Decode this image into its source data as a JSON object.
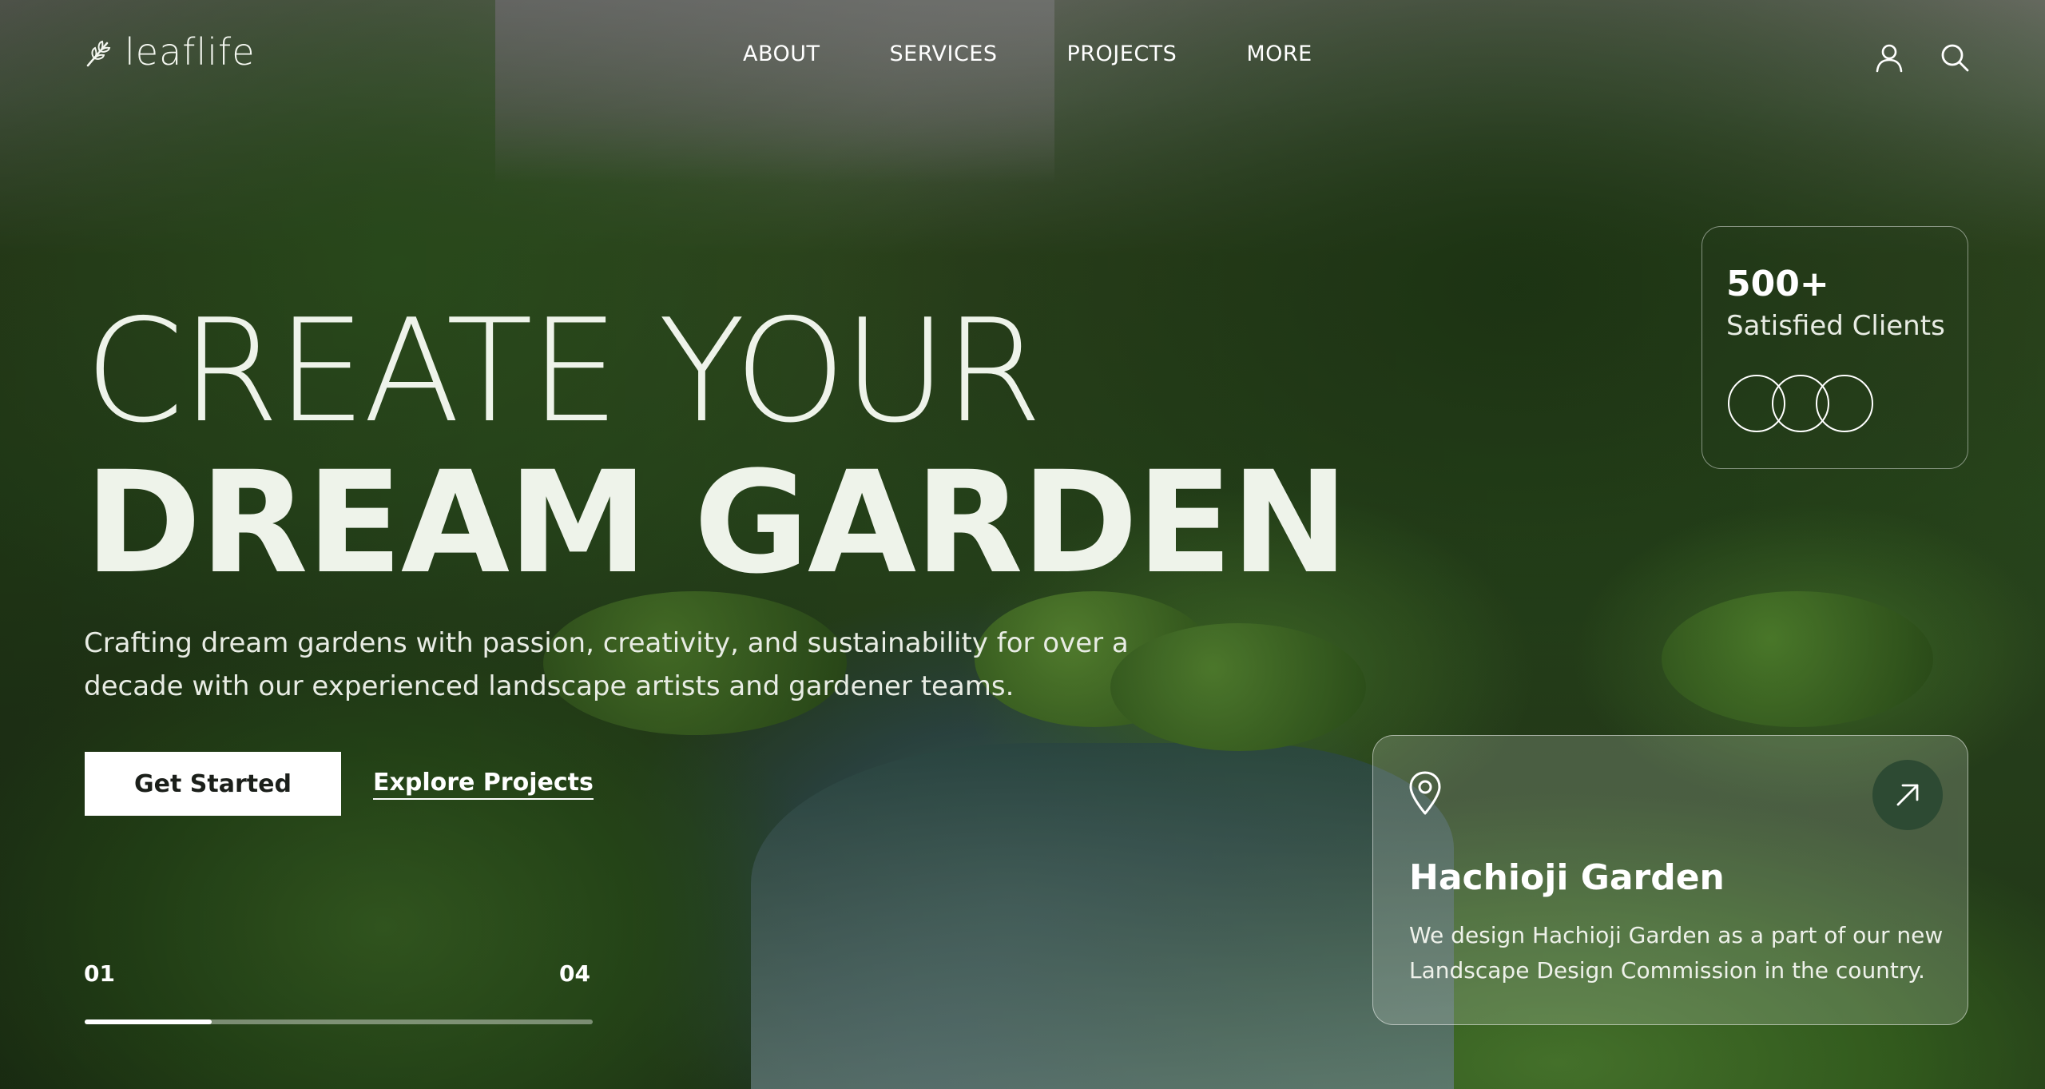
{
  "brand": {
    "name": "leaflife",
    "accent": "#2d4a33",
    "text_color": "#f4f7f0"
  },
  "nav": {
    "items": [
      {
        "label": "ABOUT"
      },
      {
        "label": "SERVICES"
      },
      {
        "label": "PROJECTS"
      },
      {
        "label": "MORE"
      }
    ],
    "icons": [
      "user-icon",
      "search-icon"
    ]
  },
  "hero": {
    "headline_line1": "CREATE YOUR",
    "headline_line2": "DREAM GARDEN",
    "subtitle": "Crafting dream gardens with passion, creativity, and sustainability for over a decade with our experienced landscape artists and gardener teams.",
    "primary_button": "Get Started",
    "secondary_link": "Explore Projects"
  },
  "slider": {
    "current": "01",
    "total": "04",
    "progress_fraction": 0.25
  },
  "stats": {
    "value": "500+",
    "label": "Satisfied Clients",
    "icons": [
      "avatar-circle",
      "avatar-circle",
      "avatar-circle"
    ]
  },
  "project": {
    "title": "Hachioji Garden",
    "description": "We design Hachioji Garden as a part of our new Landscape Design Commission in the country.",
    "icons": [
      "location-pin-icon",
      "arrow-up-right-icon"
    ]
  }
}
